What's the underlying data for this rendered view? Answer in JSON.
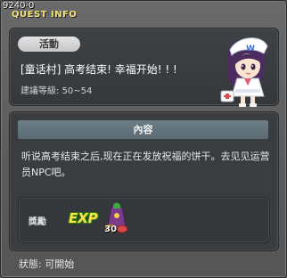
{
  "window": {
    "quest_id": "9240-0",
    "title": "QUEST INFO"
  },
  "quest": {
    "tag": "活動",
    "title": "[童话村] 高考结束! 幸福开始! ! !",
    "level": "建議等級: 50~54"
  },
  "content": {
    "header": "內容",
    "description": "听说高考结束之后,现在正在发放祝福的饼干。去见见运营员NPC吧。"
  },
  "reward": {
    "label": "獎勵",
    "exp_text": "EXP",
    "item_quantity": "30"
  },
  "footer": {
    "status": "狀態: 可開始"
  },
  "icons": {
    "npc": "npc-nurse-portrait-icon",
    "exp": "exp-icon",
    "item": "cookie-bag-item-icon"
  }
}
